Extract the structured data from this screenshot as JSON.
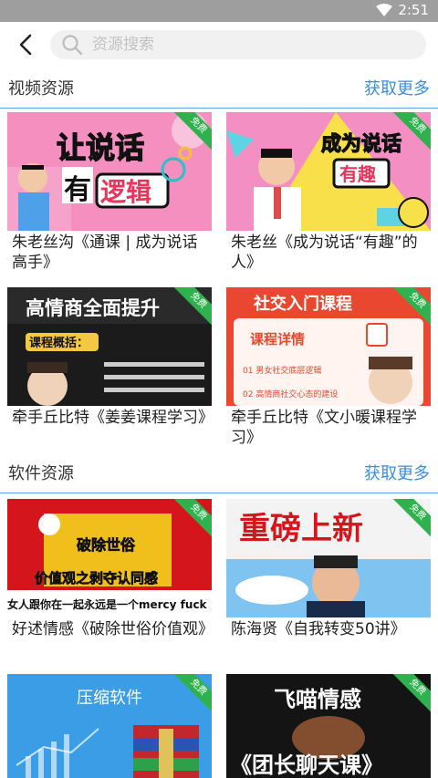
{
  "status": {
    "time": "2:51"
  },
  "search": {
    "placeholder": "资源搜索"
  },
  "sections": [
    {
      "title": "视频资源",
      "more": "获取更多",
      "items": [
        {
          "title": "朱老丝沟《通课 | 成为说话高手》",
          "thumb_text": [
            "让说话",
            "有",
            "逻辑"
          ],
          "badge": "免费"
        },
        {
          "title": "朱老丝《成为说话“有趣”的人》",
          "thumb_text": [
            "成为说话",
            "有趣"
          ],
          "badge": "免费"
        },
        {
          "title": "牵手丘比特《姜姜课程学习》",
          "thumb_text": [
            "高情商全面提升",
            "课程概括："
          ],
          "badge": "免费"
        },
        {
          "title": "牵手丘比特《文小暖课程学习》",
          "thumb_text": [
            "社交入门课程",
            "课程详情",
            "01 男女社交底层逻辑",
            "02 高情商社交心态的建设"
          ],
          "badge": "免费"
        }
      ]
    },
    {
      "title": "软件资源",
      "more": "获取更多",
      "items": [
        {
          "title": "好述情感《破除世俗价值观》",
          "thumb_text": [
            "破除世俗",
            "价值观之剥夺认同感",
            "女人跟你在一起永远是一个mercy fuck"
          ],
          "badge": "免费"
        },
        {
          "title": "陈海贤《自我转变50讲》",
          "thumb_text": [
            "重磅上新"
          ],
          "badge": "免费"
        },
        {
          "title": "",
          "thumb_text": [
            "压缩软件"
          ],
          "badge": "免费"
        },
        {
          "title": "",
          "thumb_text": [
            "飞喵情感",
            "《团长聊天课》"
          ],
          "badge": "免费"
        }
      ]
    }
  ]
}
